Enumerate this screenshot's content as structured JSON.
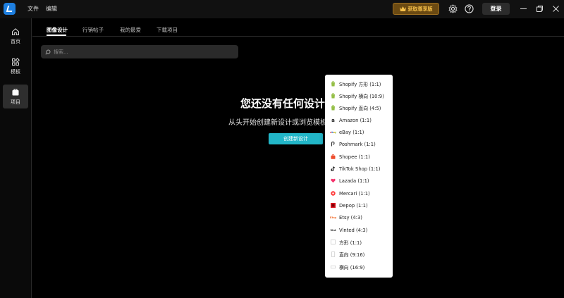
{
  "titlebar": {
    "menu": [
      "文件",
      "编辑"
    ],
    "premium_label": "获取尊享版",
    "login_label": "登录"
  },
  "sidebar": {
    "items": [
      {
        "label": "首页",
        "icon": "home-icon"
      },
      {
        "label": "模板",
        "icon": "grid-icon"
      },
      {
        "label": "项目",
        "icon": "briefcase-icon",
        "active": true
      }
    ]
  },
  "tabs": [
    "图像设计",
    "行销帖子",
    "我的最爱",
    "下载项目"
  ],
  "search": {
    "placeholder": "搜索..."
  },
  "empty_state": {
    "title": "您还没有任何设计",
    "subtitle": "从头开始创建新设计或浏览模板",
    "create_button": "创建新设计"
  },
  "dropdown": {
    "items": [
      {
        "label": "Shopify 方形 (1:1)",
        "icon": "shopify-icon",
        "color": "#95bf47"
      },
      {
        "label": "Shopify 横向 (10:9)",
        "icon": "shopify-icon",
        "color": "#95bf47"
      },
      {
        "label": "Shopify 直向 (4:5)",
        "icon": "shopify-icon",
        "color": "#95bf47"
      },
      {
        "label": "Amazon (1:1)",
        "icon": "amazon-icon",
        "color": "#222222"
      },
      {
        "label": "eBay (1:1)",
        "icon": "ebay-icon",
        "color": "#e53238"
      },
      {
        "label": "Poshmark (1:1)",
        "icon": "poshmark-icon",
        "color": "#7f0353"
      },
      {
        "label": "Shopee (1:1)",
        "icon": "shopee-icon",
        "color": "#ee4d2d"
      },
      {
        "label": "TikTok Shop (1:1)",
        "icon": "tiktok-icon",
        "color": "#111111"
      },
      {
        "label": "Lazada (1:1)",
        "icon": "lazada-icon",
        "color": "#f5336c"
      },
      {
        "label": "Mercari (1:1)",
        "icon": "mercari-icon",
        "color": "#ff3b3b"
      },
      {
        "label": "Depop (1:1)",
        "icon": "depop-icon",
        "color": "#e0141e"
      },
      {
        "label": "Etsy (4:3)",
        "icon": "etsy-icon",
        "color": "#f1641e"
      },
      {
        "label": "Vinted (4:3)",
        "icon": "vinted-icon",
        "color": "#222222"
      },
      {
        "label": "方形 (1:1)",
        "icon": "square-outline-icon",
        "color": "#cccccc"
      },
      {
        "label": "直向 (9:16)",
        "icon": "portrait-outline-icon",
        "color": "#cccccc"
      },
      {
        "label": "横向 (16:9)",
        "icon": "landscape-outline-icon",
        "color": "#cccccc"
      }
    ]
  }
}
